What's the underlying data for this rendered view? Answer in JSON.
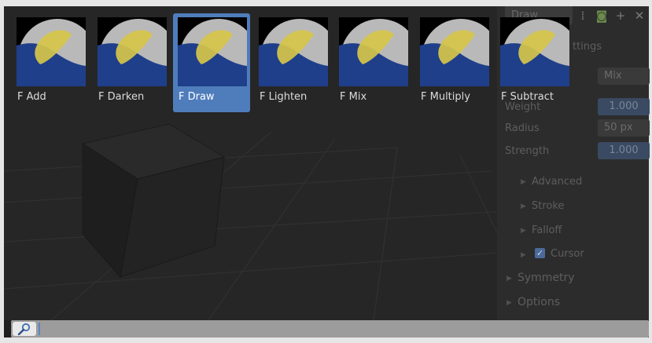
{
  "brushes": [
    {
      "label": "F Add",
      "active": false
    },
    {
      "label": "F Darken",
      "active": false
    },
    {
      "label": "F Draw",
      "active": true
    },
    {
      "label": "F Lighten",
      "active": false
    },
    {
      "label": "F Mix",
      "active": false
    },
    {
      "label": "F Multiply",
      "active": false
    },
    {
      "label": "F Subtract",
      "active": false
    }
  ],
  "search": {
    "value": "",
    "icon": "magnifier-icon"
  },
  "background_panel": {
    "tab_label": "Draw",
    "settings_label": "ttings",
    "blend_value": "Mix",
    "weight_label": "Weight",
    "weight_value": "1.000",
    "radius_label": "Radius",
    "radius_value": "50 px",
    "strength_label": "Strength",
    "strength_value": "1.000",
    "sections": [
      "Advanced",
      "Stroke",
      "Falloff",
      "Cursor"
    ],
    "panels": [
      "Symmetry",
      "Options"
    ]
  },
  "colors": {
    "accent": "#4f7dbb",
    "thumb_blue": "#1f3f8a",
    "thumb_grey": "#b9b9b9",
    "thumb_yellow": "#d6c64a"
  }
}
